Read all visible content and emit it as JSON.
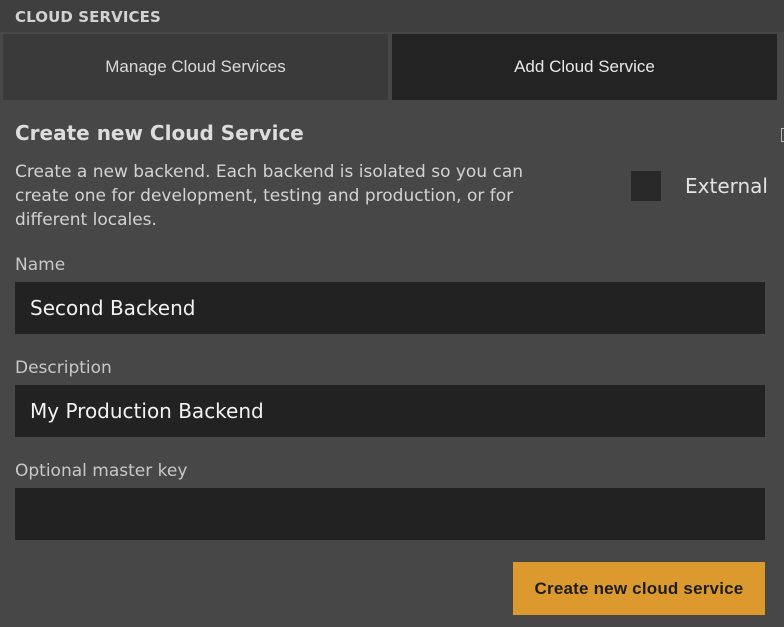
{
  "panel": {
    "title": "CLOUD SERVICES"
  },
  "tabs": [
    {
      "label": "Manage Cloud Services",
      "active": false
    },
    {
      "label": "Add Cloud Service",
      "active": true
    }
  ],
  "form": {
    "heading": "Create new Cloud Service",
    "description": "Create a new backend. Each backend is isolated so you can create one for development, testing and production, or for different locales.",
    "external": {
      "label": "External",
      "checked": false
    },
    "fields": {
      "name": {
        "label": "Name",
        "value": "Second Backend"
      },
      "description": {
        "label": "Description",
        "value": "My Production Backend"
      },
      "master_key": {
        "label": "Optional master key",
        "value": ""
      }
    },
    "submit_label": "Create new cloud service"
  },
  "colors": {
    "background": "#474747",
    "header": "#3f3f3f",
    "tab_inactive": "#3a3a3a",
    "tab_active": "#232323",
    "input": "#222222",
    "accent": "#dc9a2e"
  }
}
